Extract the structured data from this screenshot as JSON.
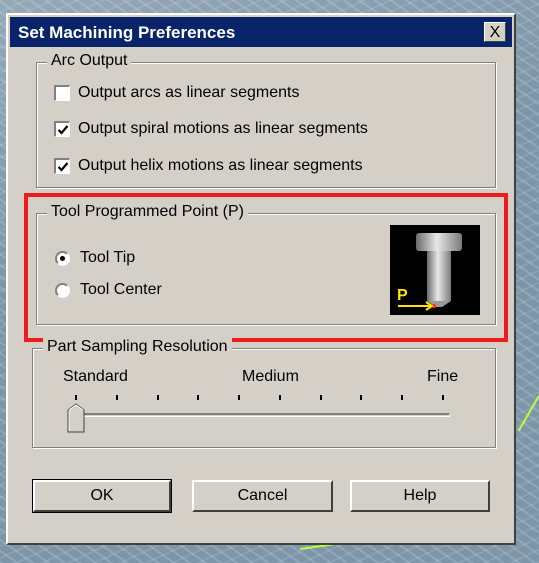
{
  "dialog": {
    "title": "Set Machining Preferences",
    "close_symbol": "X"
  },
  "arc_output": {
    "legend": "Arc Output",
    "options": [
      {
        "label": "Output arcs as linear segments",
        "checked": false
      },
      {
        "label": "Output spiral motions as linear segments",
        "checked": true
      },
      {
        "label": "Output helix motions as linear segments",
        "checked": true
      }
    ]
  },
  "tool_point": {
    "legend": "Tool Programmed Point (P)",
    "options": [
      {
        "label": "Tool Tip",
        "selected": true
      },
      {
        "label": "Tool Center",
        "selected": false
      }
    ],
    "image_label": "P"
  },
  "sampling": {
    "legend": "Part Sampling Resolution",
    "labels": {
      "left": "Standard",
      "middle": "Medium",
      "right": "Fine"
    },
    "tick_count": 10,
    "value_position": 0
  },
  "buttons": {
    "ok": "OK",
    "cancel": "Cancel",
    "help": "Help"
  },
  "colors": {
    "title_bar": "#0a246a",
    "highlight": "#ee1c1c",
    "dialog_face": "#d4d0c8"
  }
}
